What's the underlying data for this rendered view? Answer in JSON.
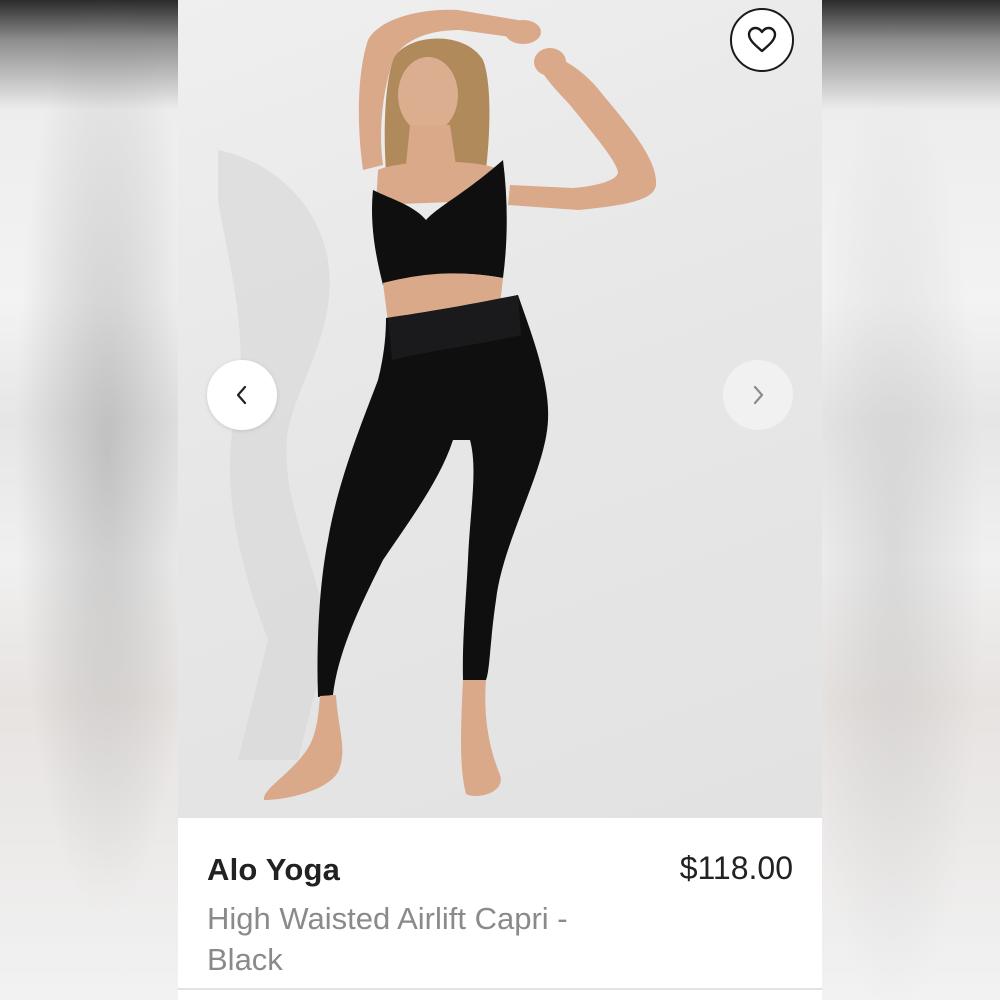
{
  "listing": {
    "brand": "Alo Yoga",
    "price": "$118.00",
    "title": "High Waisted Airlift Capri - Black"
  },
  "photo": {
    "subject": "product-photo",
    "outfit_color": "#0f0f10",
    "skin_color": "#d9a98a",
    "hair_color": "#b08a5a"
  },
  "controls": {
    "favorite_icon": "heart-outline-icon",
    "prev_icon": "chevron-left-icon",
    "next_icon": "chevron-right-icon"
  }
}
